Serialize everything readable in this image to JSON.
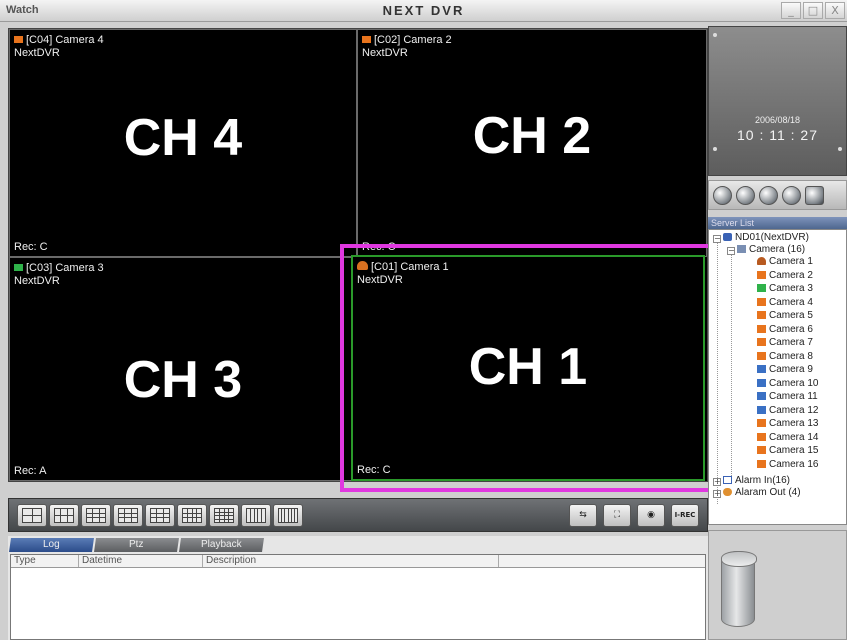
{
  "window": {
    "app_name": "Watch",
    "title": "NEXT DVR",
    "controls": [
      "_",
      "□",
      "X"
    ]
  },
  "cells": [
    {
      "id": "ch4",
      "label": "[C04] Camera 4",
      "server": "NextDVR",
      "channel": "CH 4",
      "rec": "Rec: C",
      "icon": "camera-icon",
      "color": "#e8741d"
    },
    {
      "id": "ch2",
      "label": "[C02] Camera 2",
      "server": "NextDVR",
      "channel": "CH 2",
      "rec": "Rec: C",
      "icon": "camera-icon",
      "color": "#e8741d"
    },
    {
      "id": "ch3",
      "label": "[C03] Camera 3",
      "server": "NextDVR",
      "channel": "CH 3",
      "rec": "Rec: A",
      "icon": "camera-icon",
      "color": "#2fb24a"
    },
    {
      "id": "ch1",
      "label": "[C01] Camera 1",
      "server": "NextDVR",
      "channel": "CH 1",
      "rec": "Rec: C",
      "icon": "dome-camera-icon",
      "color": "#e8741d"
    }
  ],
  "toolbar": {
    "layouts": [
      "layout-1x1",
      "layout-4",
      "layout-6",
      "layout-8",
      "layout-9",
      "layout-10",
      "layout-13",
      "layout-16",
      "layout-25"
    ],
    "actions": [
      {
        "name": "sequence-button",
        "icon": "⇆"
      },
      {
        "name": "fullscreen-button",
        "icon": "⛶"
      },
      {
        "name": "ptz-button",
        "icon": "◉"
      },
      {
        "name": "instant-rec-button",
        "label": "I-REC"
      }
    ],
    "highlight_color": "#e038e0"
  },
  "log": {
    "tabs": [
      "Log",
      "Ptz",
      "Playback"
    ],
    "active_tab": "Log",
    "columns": [
      "Type",
      "Datetime",
      "Description"
    ]
  },
  "clock": {
    "date": "2006/08/18",
    "time": "10 : 11 : 27"
  },
  "server_list": {
    "header": "Server List",
    "server": "ND01(NextDVR)",
    "camera_group": "Camera (16)",
    "cameras": [
      "Camera 1",
      "Camera 2",
      "Camera 3",
      "Camera 4",
      "Camera 5",
      "Camera 6",
      "Camera 7",
      "Camera 8",
      "Camera 9",
      "Camera 10",
      "Camera 11",
      "Camera 12",
      "Camera 13",
      "Camera 14",
      "Camera 15",
      "Camera 16"
    ],
    "camera_icons": [
      "dome",
      "cam-o",
      "cam-g",
      "cam-o",
      "cam-o",
      "cam-o",
      "cam-o",
      "cam-o",
      "cam-b",
      "cam-b",
      "cam-b",
      "cam-b",
      "cam-o",
      "cam-o",
      "cam-o",
      "cam-o"
    ],
    "alarm_in": "Alarm In(16)",
    "alarm_out": "Alaram Out (4)"
  }
}
